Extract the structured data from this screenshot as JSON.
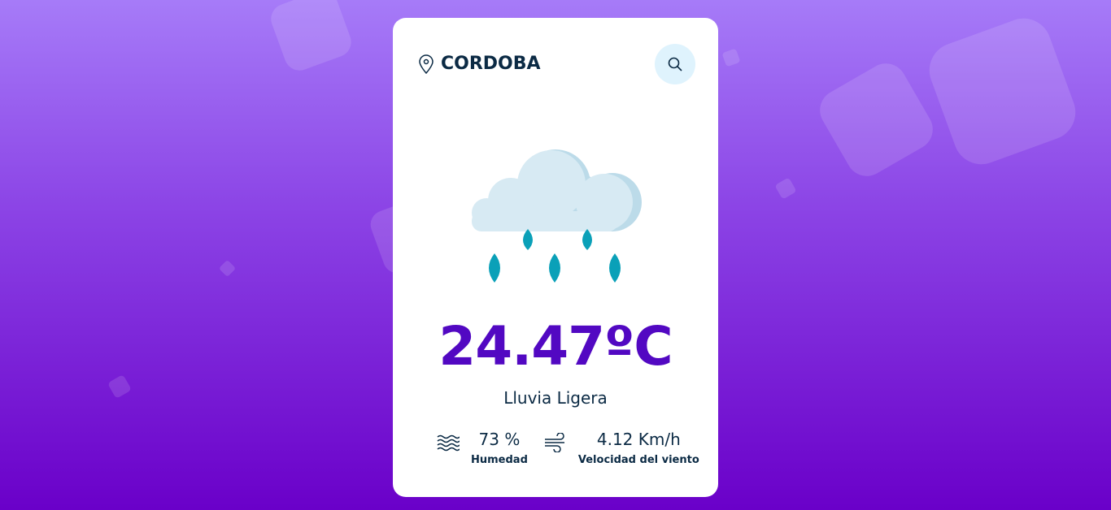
{
  "location": {
    "city": "CORDOBA"
  },
  "weather": {
    "temperature": "24.47ºC",
    "description": "Lluvia Ligera",
    "humidity": {
      "value": "73 %",
      "label": "Humedad"
    },
    "wind": {
      "value": "4.12 Km/h",
      "label": "Velocidad del viento"
    }
  },
  "colors": {
    "accent": "#5208c2",
    "text": "#0b2a44",
    "search_bg": "#dff3fd"
  }
}
